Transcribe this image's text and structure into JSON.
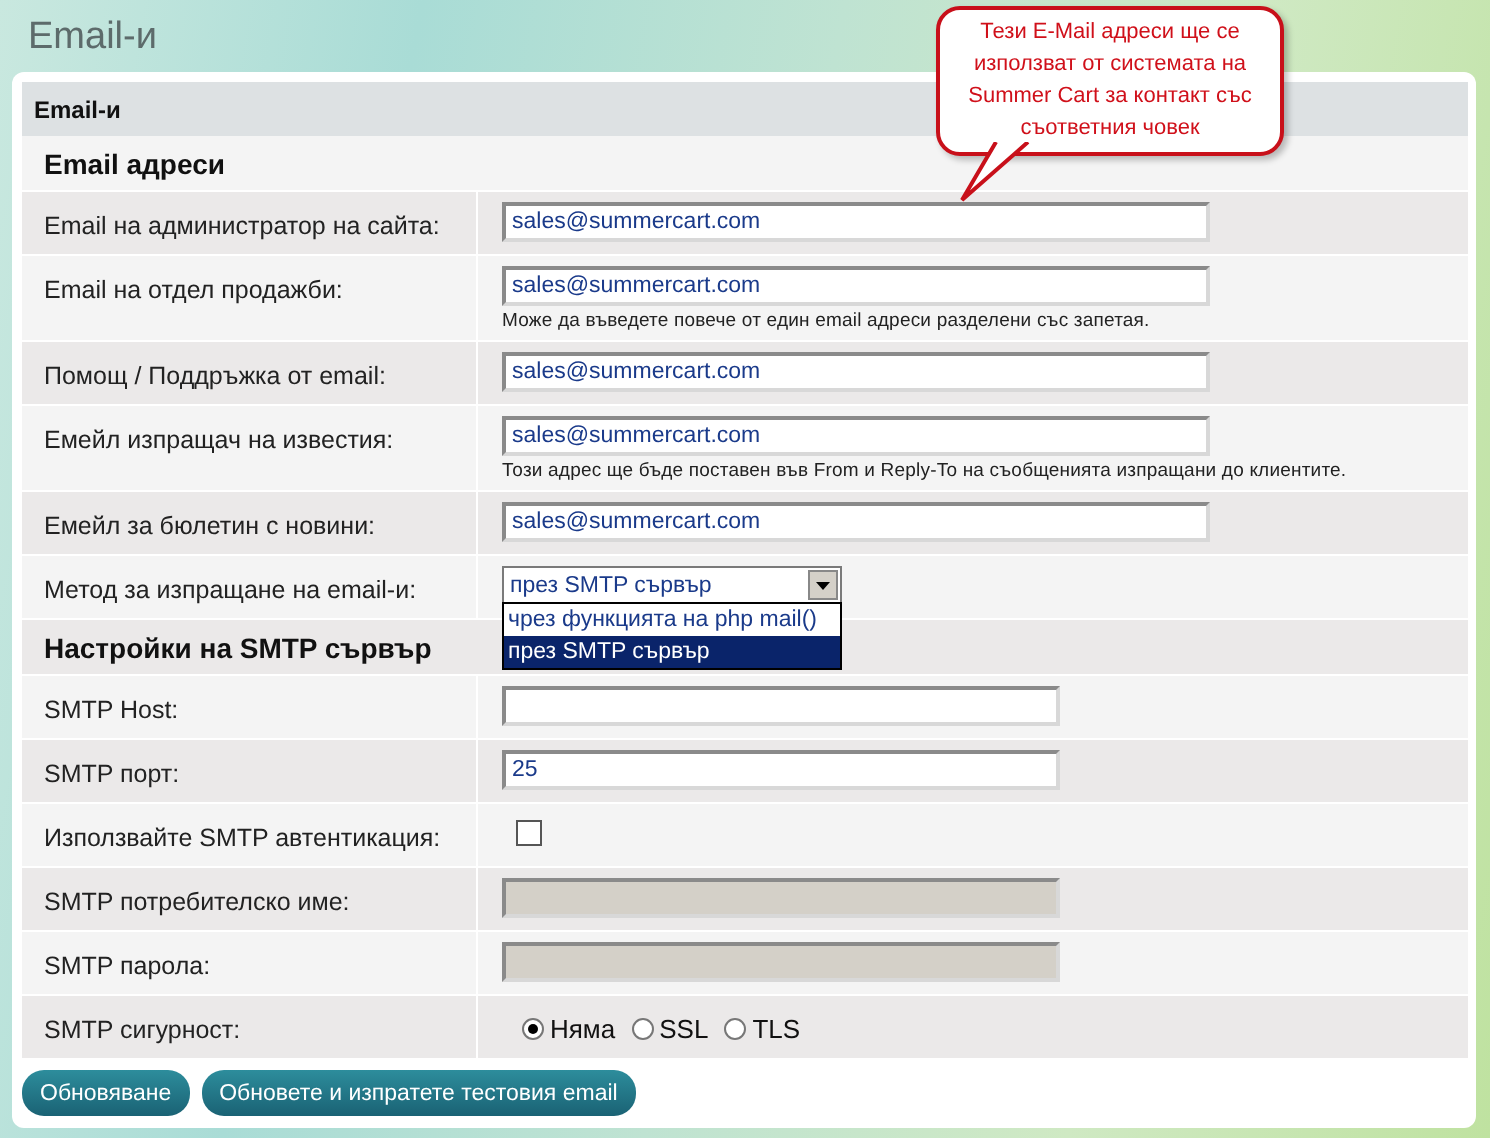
{
  "page_title": "Email-и",
  "callout": {
    "text": "Тези E-Mail адреси ще се използват от системата на Summer Cart за контакт със съответния човек"
  },
  "panel": {
    "title": "Email-и"
  },
  "sections": [
    {
      "title": "Email адреси",
      "rows": [
        {
          "kind": "text",
          "label": "Email на администратор на сайта:",
          "value": "sales@summercart.com"
        },
        {
          "kind": "text",
          "label": "Email на отдел продажби:",
          "value": "sales@summercart.com",
          "hint": "Може да въведете повече от един email адреси разделени със запетая."
        },
        {
          "kind": "text",
          "label": "Помощ / Поддръжка от email:",
          "value": "sales@summercart.com"
        },
        {
          "kind": "text",
          "label": "Емейл изпращач на известия:",
          "value": "sales@summercart.com",
          "hint": "Този адрес ще бъде поставен във From и Reply-To на съобщенията изпращани до клиентите."
        },
        {
          "kind": "text",
          "label": "Емейл за бюлетин с новини:",
          "value": "sales@summercart.com"
        },
        {
          "kind": "select",
          "label": "Метод за изпращане на email-и:",
          "value": "през SMTP сървър",
          "expanded": true,
          "options": [
            {
              "label": "чрез функцията на php mail()",
              "selected": false
            },
            {
              "label": "през SMTP сървър",
              "selected": true
            }
          ]
        }
      ]
    },
    {
      "title": "Настройки на SMTP сървър",
      "rows": [
        {
          "kind": "text",
          "label": "SMTP Host:",
          "disabled": false
        },
        {
          "kind": "text",
          "label": "SMTP порт:",
          "value": "25",
          "disabled": false
        },
        {
          "kind": "checkbox",
          "label": "Използвайте SMTP автентикация:",
          "checked": false
        },
        {
          "kind": "text",
          "label": "SMTP потребителско име:",
          "disabled": true
        },
        {
          "kind": "text",
          "label": "SMTP парола:",
          "disabled": true
        },
        {
          "kind": "radio",
          "label": "SMTP сигурност:",
          "options": [
            {
              "label": "Няма",
              "selected": true
            },
            {
              "label": "SSL",
              "selected": false
            },
            {
              "label": "TLS",
              "selected": false
            }
          ]
        }
      ]
    }
  ],
  "buttons": [
    "Обновяване",
    "Обновете и изпратете тестовия email"
  ]
}
